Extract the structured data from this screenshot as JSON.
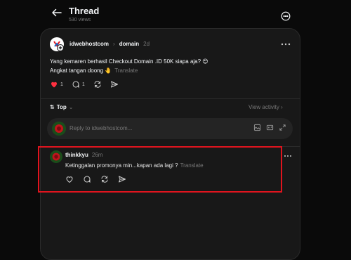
{
  "header": {
    "title": "Thread",
    "subtitle": "530 views"
  },
  "post": {
    "username": "idwebhostcom",
    "category": "domain",
    "time": "2d",
    "line1": "Yang kemaren berhasil Checkout Domain .ID 50K siapa aja? 😍",
    "line2": "Angkat tangan doong 🤚",
    "translate": "Translate",
    "likes": "1",
    "replies": "1",
    "like_color": "#ff3040"
  },
  "sort": {
    "label": "Top",
    "view_activity": "View activity"
  },
  "reply_box": {
    "placeholder": "Reply to idwebhostcom..."
  },
  "comment": {
    "username": "thinkkyu",
    "time": "26m",
    "text": "Ketinggalan promonya min...kapan ada lagi ?",
    "translate": "Translate"
  },
  "colors": {
    "accent_highlight": "#e0141e",
    "background": "#0a0a0a",
    "card": "#181818"
  }
}
